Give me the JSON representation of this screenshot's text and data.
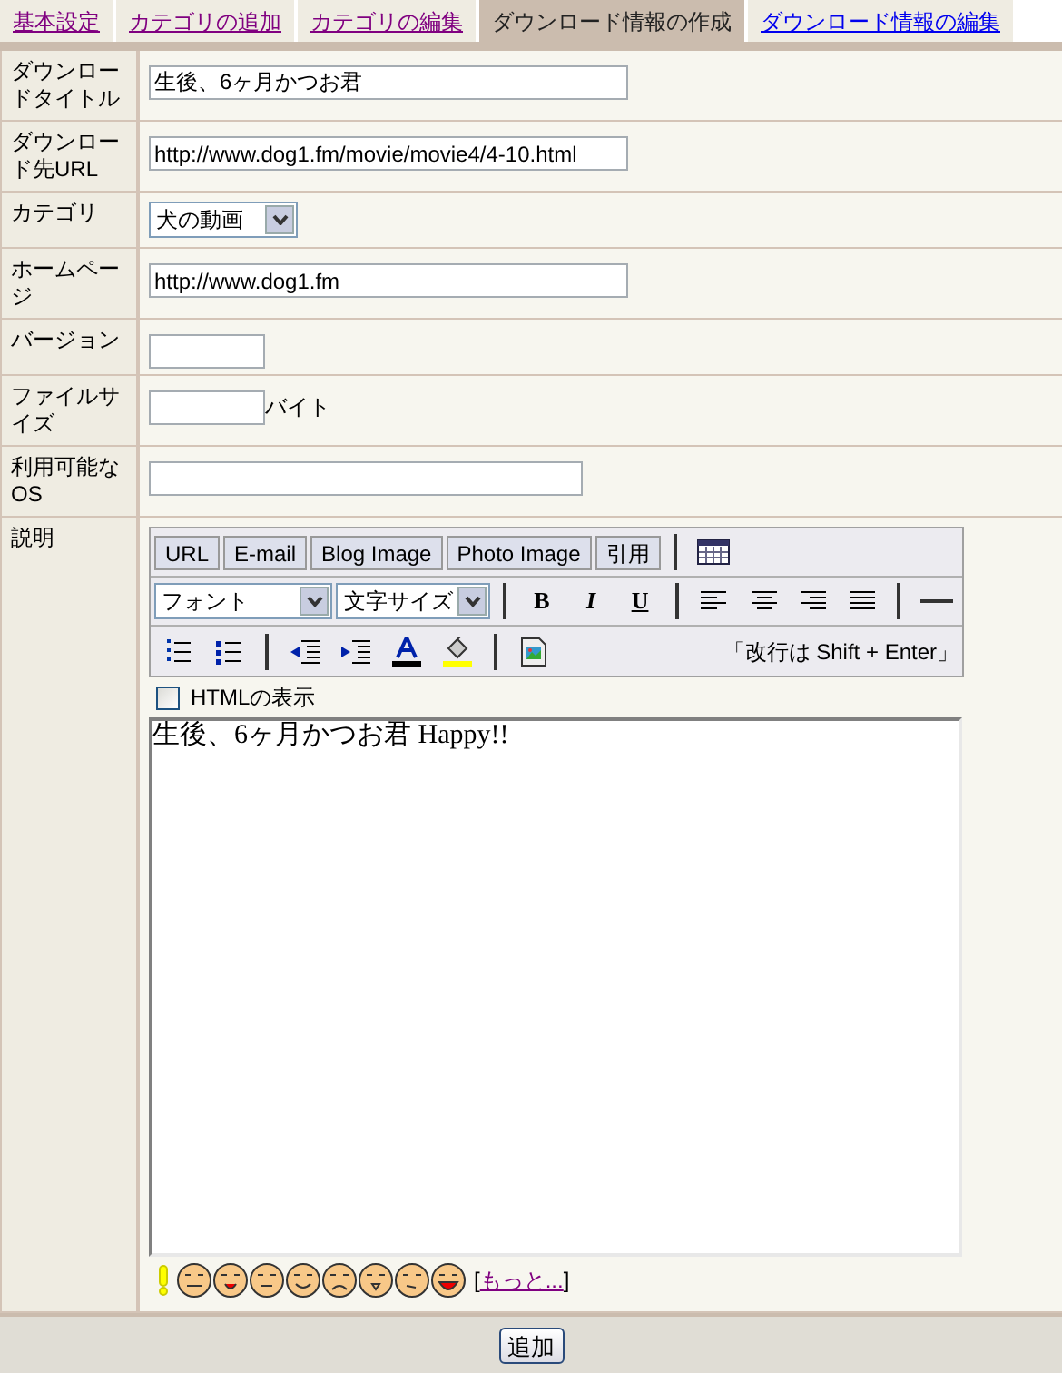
{
  "tabs": [
    {
      "label": "基本設定",
      "selected": false,
      "visited": true
    },
    {
      "label": "カテゴリの追加",
      "selected": false,
      "visited": true
    },
    {
      "label": "カテゴリの編集",
      "selected": false,
      "visited": true
    },
    {
      "label": "ダウンロード情報の作成",
      "selected": true
    },
    {
      "label": "ダウンロード情報の編集",
      "selected": false,
      "visited": false
    }
  ],
  "form": {
    "rows": [
      {
        "label": "ダウンロードタイトル",
        "kind": "text",
        "value": "生後、6ヶ月かつお君"
      },
      {
        "label": "ダウンロード先URL",
        "kind": "text",
        "value": "http://www.dog1.fm/movie/movie4/4-10.html"
      },
      {
        "label": "カテゴリ",
        "kind": "select",
        "value": "犬の動画"
      },
      {
        "label": "ホームページ",
        "kind": "text",
        "value": "http://www.dog1.fm"
      },
      {
        "label": "バージョン",
        "kind": "text"
      },
      {
        "label": "ファイルサイズ",
        "kind": "text",
        "suffix": "バイト"
      },
      {
        "label": "利用可能なOS",
        "kind": "text"
      },
      {
        "label": "説明",
        "kind": "editor"
      }
    ]
  },
  "editor": {
    "toolbar_rows": [
      [
        {
          "kind": "button",
          "label": "URL"
        },
        {
          "kind": "button",
          "label": "E-mail"
        },
        {
          "kind": "button",
          "label": "Blog Image"
        },
        {
          "kind": "button",
          "label": "Photo Image"
        },
        {
          "kind": "button",
          "label": "引用"
        },
        {
          "kind": "separator"
        },
        {
          "kind": "icon"
        }
      ],
      [
        {
          "kind": "select",
          "value": "フォント"
        },
        {
          "kind": "select",
          "value": "文字サイズ"
        },
        {
          "kind": "separator"
        },
        {
          "kind": "format",
          "label": "B"
        },
        {
          "kind": "format",
          "label": "I"
        },
        {
          "kind": "format",
          "label": "U"
        },
        {
          "kind": "separator"
        },
        {
          "kind": "icon"
        },
        {
          "kind": "icon"
        },
        {
          "kind": "icon"
        },
        {
          "kind": "icon"
        },
        {
          "kind": "separator"
        },
        {
          "kind": "icon"
        }
      ],
      [
        {
          "kind": "icon"
        },
        {
          "kind": "icon"
        },
        {
          "kind": "separator"
        },
        {
          "kind": "icon"
        },
        {
          "kind": "icon"
        },
        {
          "kind": "icon"
        },
        {
          "kind": "icon"
        },
        {
          "kind": "separator"
        },
        {
          "kind": "icon"
        },
        {
          "kind": "hint",
          "text": "「改行は Shift + Enter」"
        }
      ]
    ],
    "html_toggle": {
      "label": "HTMLの表示",
      "checked": false
    },
    "body": "生後、6ヶ月かつお君 Happy!!",
    "more": {
      "open": "[",
      "link": "もっと...",
      "close": "]"
    }
  },
  "submit": "追加"
}
